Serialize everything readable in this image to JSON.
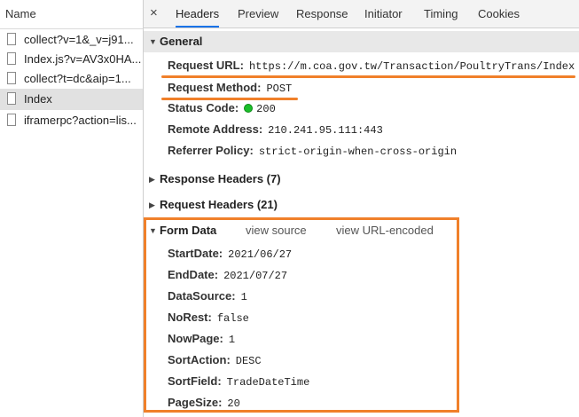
{
  "request_list": {
    "header": "Name",
    "items": [
      {
        "name": "collect?v=1&_v=j91...",
        "selected": false
      },
      {
        "name": "Index.js?v=AV3x0HA...",
        "selected": false
      },
      {
        "name": "collect?t=dc&aip=1...",
        "selected": false
      },
      {
        "name": "Index",
        "selected": true
      },
      {
        "name": "iframerpc?action=lis...",
        "selected": false
      }
    ]
  },
  "tabs": {
    "close": "×",
    "items": [
      "Headers",
      "Preview",
      "Response",
      "Initiator",
      "Timing",
      "Cookies"
    ],
    "active": "Headers"
  },
  "general": {
    "title": "General",
    "request_url_key": "Request URL:",
    "request_url": "https://m.coa.gov.tw/Transaction/PoultryTrans/Index",
    "request_method_key": "Request Method:",
    "request_method": "POST",
    "status_code_key": "Status Code:",
    "status_code": "200",
    "remote_address_key": "Remote Address:",
    "remote_address": "210.241.95.111:443",
    "referrer_policy_key": "Referrer Policy:",
    "referrer_policy": "strict-origin-when-cross-origin"
  },
  "response_headers": {
    "title": "Response Headers (7)"
  },
  "request_headers": {
    "title": "Request Headers (21)"
  },
  "form_data": {
    "title": "Form Data",
    "view_source": "view source",
    "view_url_encoded": "view URL-encoded",
    "fields": [
      {
        "key": "StartDate:",
        "value": "2021/06/27"
      },
      {
        "key": "EndDate:",
        "value": "2021/07/27"
      },
      {
        "key": "DataSource:",
        "value": "1"
      },
      {
        "key": "NoRest:",
        "value": "false"
      },
      {
        "key": "NowPage:",
        "value": "1"
      },
      {
        "key": "SortAction:",
        "value": "DESC"
      },
      {
        "key": "SortField:",
        "value": "TradeDateTime"
      },
      {
        "key": "PageSize:",
        "value": "20"
      }
    ]
  },
  "colors": {
    "highlight": "#f0802a",
    "status_ok": "#1bbf2a",
    "tab_active": "#1a73e8"
  }
}
